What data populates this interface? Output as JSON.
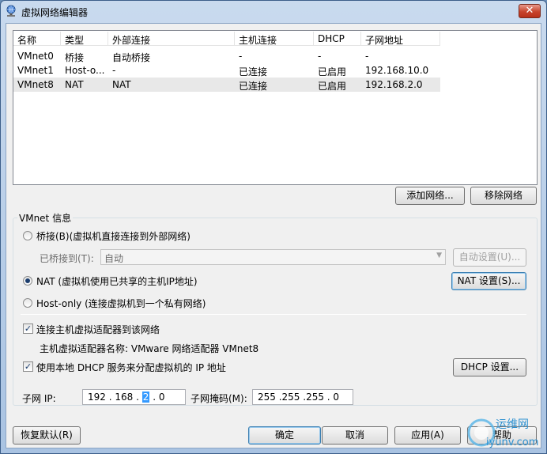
{
  "window": {
    "title": "虚拟网络编辑器",
    "close_label": "✕"
  },
  "table": {
    "headers": [
      "名称",
      "类型",
      "外部连接",
      "主机连接",
      "DHCP",
      "子网地址"
    ],
    "rows": [
      [
        "VMnet0",
        "桥接",
        "自动桥接",
        "-",
        "-",
        "-"
      ],
      [
        "VMnet1",
        "Host-o...",
        "-",
        "已连接",
        "已启用",
        "192.168.10.0"
      ],
      [
        "VMnet8",
        "NAT",
        "NAT",
        "已连接",
        "已启用",
        "192.168.2.0"
      ]
    ],
    "selected_row": 2
  },
  "buttons": {
    "add_network": "添加网络...",
    "remove_network": "移除网络",
    "auto_settings": "自动设置(U)...",
    "nat_settings": "NAT 设置(S)...",
    "dhcp_settings": "DHCP 设置...",
    "restore_defaults": "恢复默认(R)",
    "ok": "确定",
    "cancel": "取消",
    "apply": "应用(A)",
    "help": "帮助"
  },
  "vmnet_info": {
    "group_label": "VMnet 信息",
    "bridged_label": "桥接(B)(虚拟机直接连接到外部网络)",
    "bridged_to_label": "已桥接到(T):",
    "bridged_to_value": "自动",
    "nat_label": "NAT (虚拟机使用已共享的主机IP地址)",
    "hostonly_label": "Host-only (连接虚拟机到一个私有网络)",
    "selected_mode": "nat",
    "connect_adapter_label": "连接主机虚拟适配器到该网络",
    "connect_adapter_checked": true,
    "adapter_name_text": "主机虚拟适配器名称: VMware 网络适配器 VMnet8",
    "use_dhcp_label": "使用本地 DHCP 服务来分配虚拟机的 IP 地址",
    "use_dhcp_checked": true
  },
  "subnet": {
    "ip_label": "子网 IP:",
    "ip_parts": [
      "192",
      "168",
      "2",
      "0"
    ],
    "mask_label": "子网掩码(M):",
    "mask_value": "255 .255 .255 . 0"
  },
  "watermark": {
    "line1": "运维网",
    "line2": "iyunv.com"
  }
}
